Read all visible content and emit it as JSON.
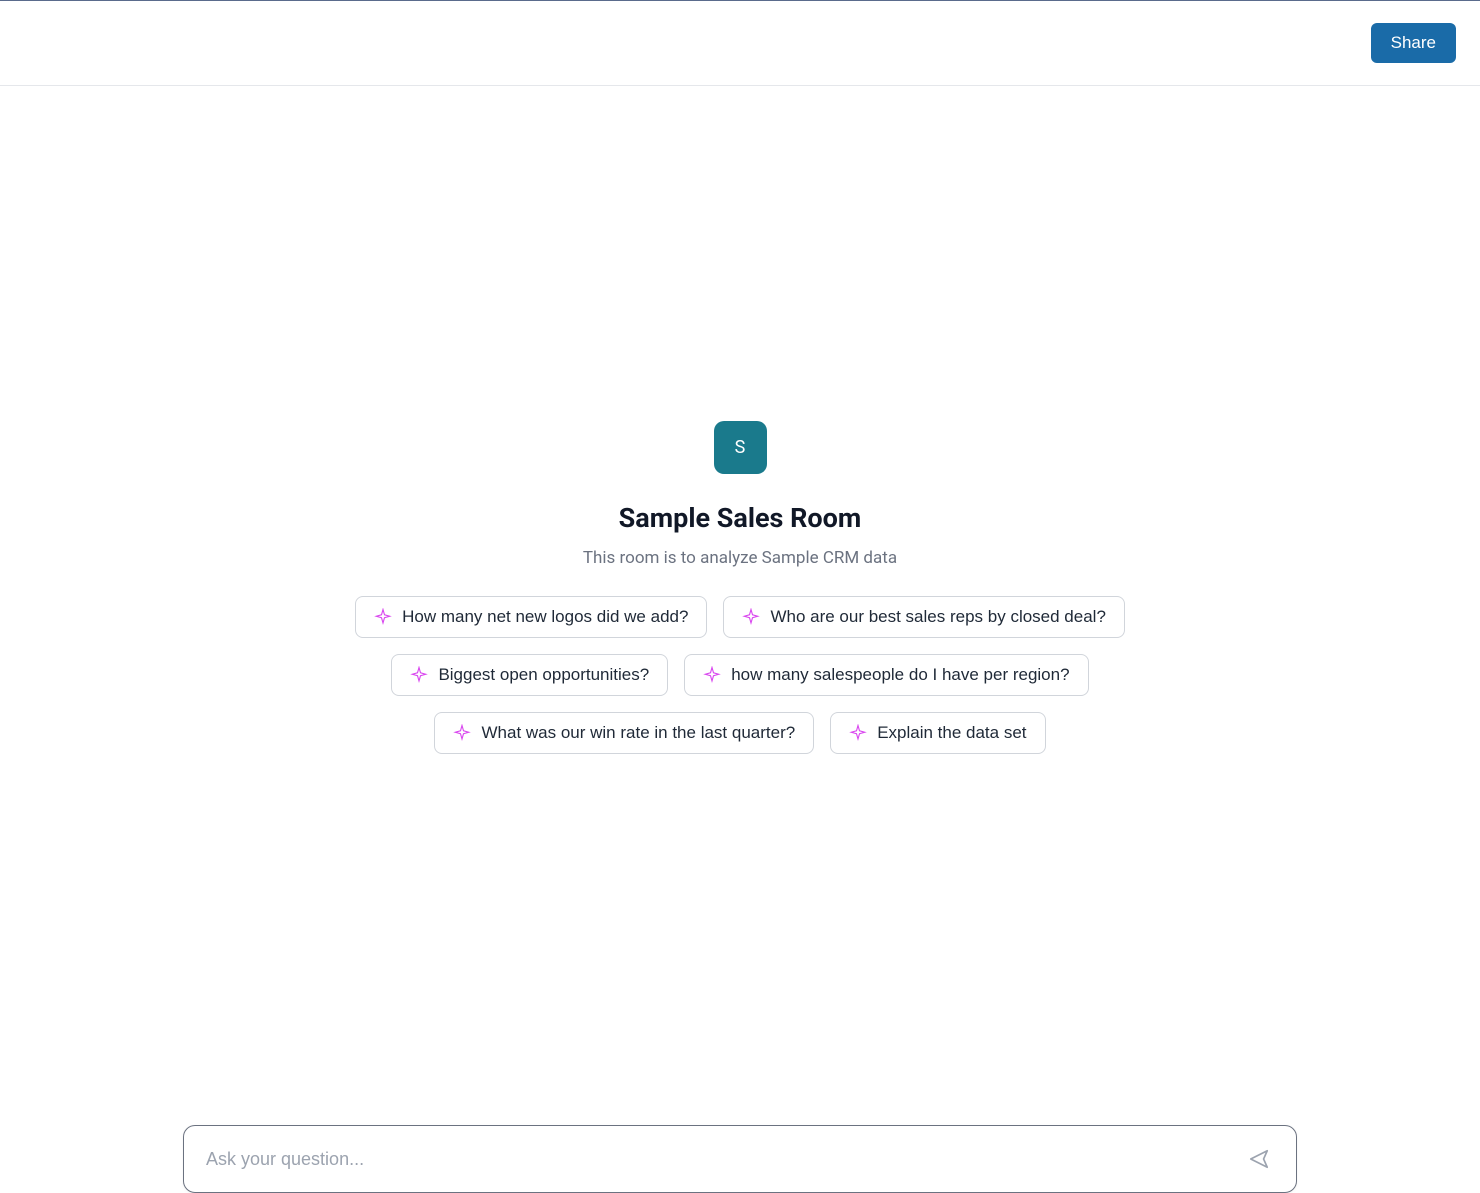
{
  "header": {
    "share_label": "Share"
  },
  "room": {
    "avatar_letter": "S",
    "title": "Sample Sales Room",
    "subtitle": "This room is to analyze Sample CRM data"
  },
  "suggestions": [
    "How many net new logos did we add?",
    "Who are our best sales reps by closed deal?",
    "Biggest open opportunities?",
    "how many salespeople do I have per region?",
    "What was our win rate in the last quarter?",
    "Explain the data set"
  ],
  "input": {
    "placeholder": "Ask your question..."
  },
  "colors": {
    "primary": "#1a6ba8",
    "avatar_bg": "#1a7a8c"
  }
}
